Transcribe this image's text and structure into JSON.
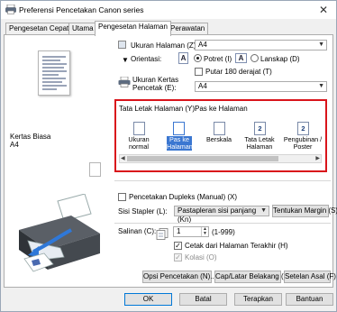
{
  "window": {
    "title": "Preferensi Pencetakan Canon                    series",
    "close_glyph": "✕"
  },
  "tabs": [
    {
      "label": "Pengesetan Cepat",
      "active": false
    },
    {
      "label": "Utama",
      "active": false
    },
    {
      "label": "Pengesetan Halaman",
      "active": true
    },
    {
      "label": "Perawatan",
      "active": false
    }
  ],
  "preview": {
    "media_label_1": "Kertas Biasa",
    "media_label_2": "A4"
  },
  "page_size": {
    "label": "Ukuran Halaman (Z):",
    "value": "A4"
  },
  "orientation": {
    "label": "Orientasi:",
    "portrait_label": "Potret (I)",
    "landscape_label": "Lanskap (D)",
    "selected": "portrait",
    "rotate_label": "Putar 180 derajat (T)",
    "rotate_checked": false,
    "icon_letter": "A"
  },
  "printer_paper": {
    "label_line1": "Ukuran Kertas",
    "label_line2": "Pencetak (E):",
    "value": "A4"
  },
  "layout": {
    "label": "Tata Letak Halaman (Y):",
    "selected_name": "Pas ke Halaman",
    "items": [
      {
        "label": "Ukuran normal",
        "icon": "",
        "selected": false
      },
      {
        "label": "Pas ke Halaman",
        "icon": "",
        "selected": true
      },
      {
        "label": "Berskala",
        "icon": "",
        "selected": false
      },
      {
        "label": "Tata Letak Halaman",
        "icon": "2",
        "selected": false
      },
      {
        "label": "Pengubinan / Poster",
        "icon": "2",
        "selected": false
      }
    ]
  },
  "duplex": {
    "label": "Pencetakan Dupleks (Manual) (X)",
    "checked": false
  },
  "stapler": {
    "label": "Sisi Stapler (L):",
    "value": "Pastapleran sisi panjang (Kn)",
    "margin_button": "Tentukan Margin (S)..."
  },
  "copies": {
    "label": "Salinan (C):",
    "value": "1",
    "range": "(1-999)",
    "reverse_label": "Cetak dari Halaman Terakhir (H)",
    "reverse_checked": true,
    "collate_label": "Kolasi (O)",
    "collate_checked": true,
    "collate_disabled": true
  },
  "buttons": {
    "print_options": "Opsi Pencetakan (N)...",
    "stamp": "Cap/Latar Belakang (B)...",
    "defaults": "Setelan Asal (F)",
    "ok": "OK",
    "cancel": "Batal",
    "apply": "Terapkan",
    "help": "Bantuan"
  },
  "colors": {
    "highlight": "#d9141b",
    "selection": "#3b77d1",
    "checkmark": "#1a1a1a"
  }
}
